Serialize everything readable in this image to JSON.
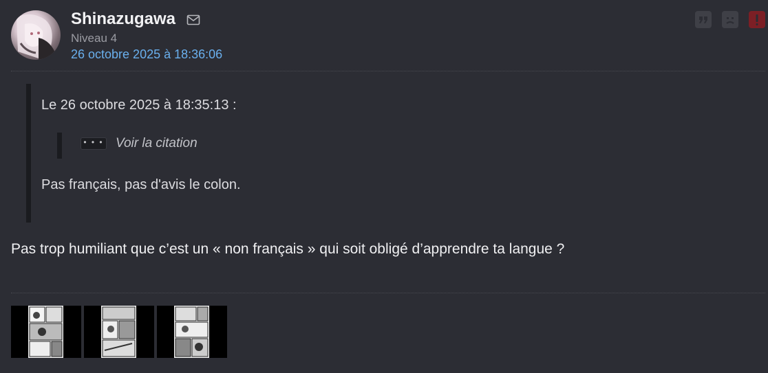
{
  "post": {
    "username": "Shinazugawa",
    "level": "Niveau 4",
    "date": "26 octobre 2025 à 18:36:06",
    "quote": {
      "header": "Le 26 octobre 2025 à 18:35:13 :",
      "nested_toggle": "• • •",
      "nested_label": "Voir la citation",
      "text": "Pas français, pas d'avis le colon."
    },
    "message": "Pas trop humiliant que c’est un « non français » qui soit obligé d’apprendre ta langue ?"
  },
  "actions": {
    "quote_icon": "quote-icon",
    "sad_icon": "sad-face-icon",
    "report_icon": "exclamation-icon",
    "report_color": "#7c1f25"
  },
  "colors": {
    "background": "#2c2d34",
    "date_link": "#6ab0ee",
    "level_text": "#9b9ca3"
  }
}
